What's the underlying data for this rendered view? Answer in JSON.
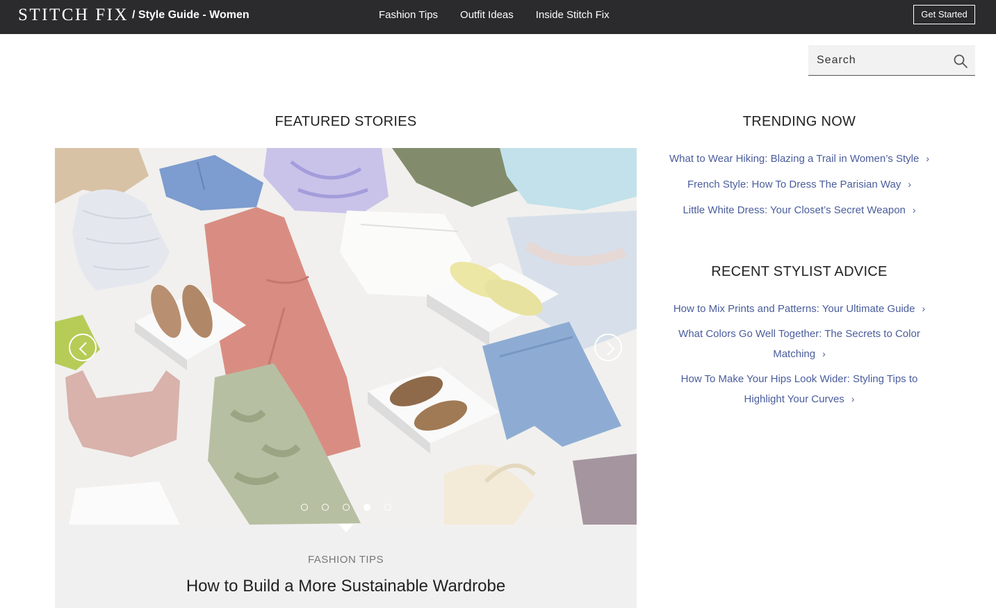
{
  "header": {
    "logo": "STITCH FIX",
    "subtitle": "/ Style Guide - Women",
    "nav": [
      "Fashion Tips",
      "Outfit Ideas",
      "Inside Stitch Fix"
    ],
    "cta": "Get Started"
  },
  "search": {
    "placeholder": "Search",
    "icon": "search-icon"
  },
  "featured": {
    "heading": "FEATURED STORIES",
    "category": "FASHION TIPS",
    "title": "How to Build a More Sustainable Wardrobe",
    "slide_count": 5,
    "active_slide": 4
  },
  "trending": {
    "heading": "TRENDING NOW",
    "links": [
      "What to Wear Hiking: Blazing a Trail in Women’s Style",
      "French Style: How To Dress The Parisian Way",
      "Little White Dress: Your Closet’s Secret Weapon"
    ]
  },
  "advice": {
    "heading": "RECENT STYLIST ADVICE",
    "links": [
      "How to Mix Prints and Patterns: Your Ultimate Guide",
      "What Colors Go Well Together: The Secrets to Color Matching",
      "How To Make Your Hips Look Wider: Styling Tips to Highlight Your Curves"
    ]
  },
  "colors": {
    "header_bg": "#2b2b2e",
    "link": "#4a5d9c",
    "caption_bg": "#f0f0f0"
  }
}
